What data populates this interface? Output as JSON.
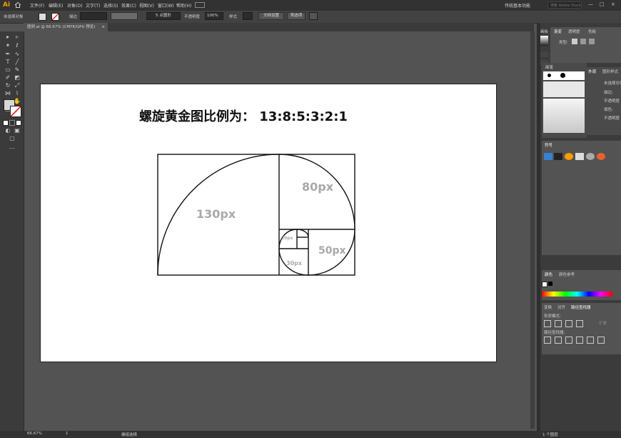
{
  "app": {
    "logo": "Ai"
  },
  "menu": [
    "文件(F)",
    "编辑(E)",
    "对象(O)",
    "文字(T)",
    "选择(S)",
    "效果(C)",
    "视图(V)",
    "窗口(W)",
    "帮助(H)"
  ],
  "workspace": "传统基本功能",
  "search_placeholder": "搜索 Adobe Stock",
  "window_controls": [
    "—",
    "□",
    "×"
  ],
  "control_bar": {
    "selection_state": "未选择对象",
    "stroke_label": "描边",
    "brush_label": "5 点圆形",
    "opacity_label": "不透明度",
    "opacity_value": "100%",
    "style_label": "样式",
    "doc_setup": "文档设置",
    "preferences": "首选项"
  },
  "document_tab": {
    "label": "图例.ai @ 66.67% (CMYK/GPU 预览)",
    "close": "×"
  },
  "artboard": {
    "title": "螺旋黄金图比例为：  13:8:5:3:2:1",
    "labels": {
      "l130": "130px",
      "l80": "80px",
      "l50": "50px",
      "l30": "30px",
      "l20": "20px"
    }
  },
  "right_panels": {
    "top_tabs": [
      "画板",
      "渐变",
      "透明度",
      "色板"
    ],
    "type_label": "类型:",
    "brush_panel_title": "画笔",
    "appearance_tabs": [
      "外观",
      "图形样式"
    ],
    "appearance_rows": [
      "未选择对象",
      "描边:",
      "不透明度",
      "填色:",
      "不透明度"
    ],
    "symbols_title": "符号",
    "color_tabs": [
      "颜色",
      "颜色参考"
    ],
    "pathfinder_tabs": [
      "变换",
      "对齐",
      "路径查找器"
    ],
    "shape_modes": "形状模式:",
    "pathfinders": "路径查找器:",
    "expand": "扩展"
  },
  "status_bar": {
    "zoom": "66.67%",
    "artboard_index": "1",
    "tool": "编组选择",
    "layers": "1 个图层"
  },
  "colors": {
    "accent": "#ff9a00",
    "menubar": "#323232",
    "panel": "#535353",
    "canvas_bg": "#535353"
  }
}
